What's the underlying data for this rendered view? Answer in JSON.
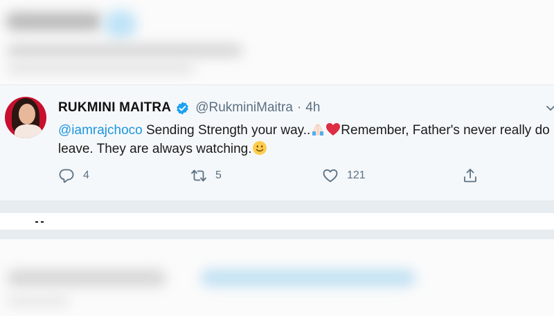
{
  "tweet": {
    "author_name": "RUKMINI MAITRA",
    "handle": "@RukminiMaitra",
    "separator": "·",
    "time": "4h",
    "mention": "@iamrajchoco",
    "text_part1": " Sending Strength your way..",
    "text_part2": "Remember, Father's never really do leave. They are always watching.",
    "emojis": [
      "folded-hands",
      "red-heart",
      "slightly-smiling-face"
    ],
    "reply_count": "4",
    "retweet_count": "5",
    "like_count": "121"
  },
  "colors": {
    "link": "#1b95e0",
    "muted": "#5b7083",
    "verified": "#1da1f2",
    "heart": "#e0245e",
    "card_bg": "#f5f8fa"
  },
  "icons": [
    "verified-badge-icon",
    "chevron-down-icon",
    "reply-icon",
    "retweet-icon",
    "like-icon",
    "share-icon"
  ]
}
